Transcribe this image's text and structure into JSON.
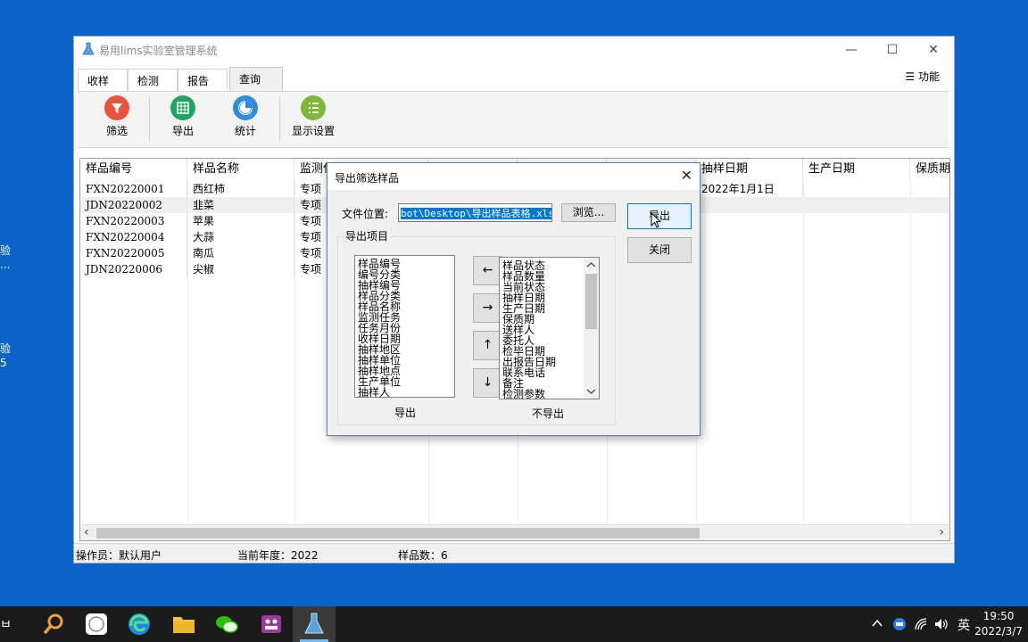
{
  "desktop": {
    "edge_labels": [
      "验",
      "...",
      "验",
      "5"
    ]
  },
  "window": {
    "title": "易用lims实验室管理系统",
    "controls": {
      "minimize": "—",
      "maximize": "☐",
      "close": "✕"
    },
    "function_menu": "☰ 功能",
    "tabs": [
      "收样",
      "检测",
      "报告",
      "查询"
    ],
    "active_tab": "查询",
    "ribbon": [
      {
        "label": "筛选",
        "icon": "filter-icon",
        "color": "#e8533f"
      },
      {
        "label": "导出",
        "icon": "table-export-icon",
        "color": "#1fa463"
      },
      {
        "label": "统计",
        "icon": "pie-chart-icon",
        "color": "#2e8be0"
      },
      {
        "label": "显示设置",
        "icon": "list-settings-icon",
        "color": "#7cb83a"
      }
    ]
  },
  "grid": {
    "columns": [
      "样品编号",
      "样品名称",
      "监测任务",
      "",
      "",
      "",
      "抽样日期",
      "生产日期",
      "保质期"
    ],
    "rows": [
      {
        "id": "FXN20220001",
        "name": "西红柿",
        "task": "专项",
        "sample_date": "2022年1月1日"
      },
      {
        "id": "JDN20220002",
        "name": "韭菜",
        "task": "专项",
        "sample_date": ""
      },
      {
        "id": "FXN20220003",
        "name": "苹果",
        "task": "专项",
        "sample_date": ""
      },
      {
        "id": "FXN20220004",
        "name": "大蒜",
        "task": "专项",
        "sample_date": ""
      },
      {
        "id": "FXN20220005",
        "name": "南瓜",
        "task": "专项",
        "sample_date": ""
      },
      {
        "id": "JDN20220006",
        "name": "尖椒",
        "task": "专项",
        "sample_date": ""
      }
    ],
    "scroll_left": "‹",
    "scroll_right": "›"
  },
  "status": {
    "operator": "操作员：默认用户",
    "year": "当前年度：2022",
    "count": "样品数：6"
  },
  "dialog": {
    "title": "导出筛选样品",
    "close": "✕",
    "file_label": "文件位置:",
    "file_value": "bot\\Desktop\\导出样品表格.xls",
    "browse": "浏览...",
    "export_button": "导出",
    "close_button": "关闭",
    "group_label": "导出项目",
    "export_list_label": "导出",
    "no_export_list_label": "不导出",
    "export_items": [
      "样品编号",
      "编号分类",
      "抽样编号",
      "样品分类",
      "样品名称",
      "监测任务",
      "任务月份",
      "收样日期",
      "抽样地区",
      "抽样单位",
      "抽样地点",
      "生产单位",
      "抽样人"
    ],
    "no_export_items": [
      "样品状态",
      "样品数量",
      "当前状态",
      "抽样日期",
      "生产日期",
      "保质期",
      "送样人",
      "委托人",
      "检毕日期",
      "出报告日期",
      "联系电话",
      "备注",
      "检测参数"
    ],
    "move_buttons": [
      "←",
      "→",
      "↑",
      "↓"
    ]
  },
  "taskbar": {
    "tray": {
      "ime": "英",
      "time": "19:50",
      "date": "2022/3/7"
    },
    "edge_text": "ㅂ"
  }
}
